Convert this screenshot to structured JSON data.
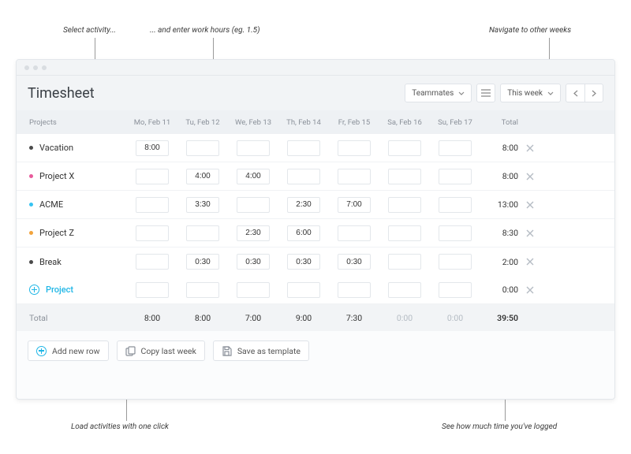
{
  "annotations": {
    "select_activity": "Select activity...",
    "enter_hours": "... and enter work hours (eg. 1.5)",
    "navigate_weeks": "Navigate to other weeks",
    "load_activities": "Load activities with one click",
    "see_logged": "See how much time you've logged"
  },
  "header": {
    "title": "Timesheet",
    "teammates_label": "Teammates",
    "period_label": "This week"
  },
  "columns": {
    "projects": "Projects",
    "days": [
      "Mo, Feb 11",
      "Tu, Feb 12",
      "We, Feb 13",
      "Th, Feb 14",
      "Fr, Feb 15",
      "Sa, Feb 16",
      "Su, Feb 17"
    ],
    "total": "Total"
  },
  "rows": [
    {
      "name": "Vacation",
      "color": "#4a4a4a",
      "values": [
        "8:00",
        "",
        "",
        "",
        "",
        "",
        ""
      ],
      "total": "8:00"
    },
    {
      "name": "Project X",
      "color": "#e85a9b",
      "values": [
        "",
        "4:00",
        "4:00",
        "",
        "",
        "",
        ""
      ],
      "total": "8:00"
    },
    {
      "name": "ACME",
      "color": "#35c3f2",
      "values": [
        "",
        "3:30",
        "",
        "2:30",
        "7:00",
        "",
        ""
      ],
      "total": "13:00"
    },
    {
      "name": "Project Z",
      "color": "#f2a33c",
      "values": [
        "",
        "",
        "2:30",
        "6:00",
        "",
        "",
        ""
      ],
      "total": "8:30"
    },
    {
      "name": "Break",
      "color": "#4a4a4a",
      "values": [
        "",
        "0:30",
        "0:30",
        "0:30",
        "0:30",
        "",
        ""
      ],
      "total": "2:00"
    }
  ],
  "add_project": {
    "label": "Project",
    "total": "0:00"
  },
  "footer": {
    "label": "Total",
    "values": [
      "8:00",
      "8:00",
      "7:00",
      "9:00",
      "7:30",
      "0:00",
      "0:00"
    ],
    "grand_total": "39:50"
  },
  "actions": {
    "add_row": "Add new row",
    "copy_last": "Copy last week",
    "save_template": "Save as template"
  }
}
